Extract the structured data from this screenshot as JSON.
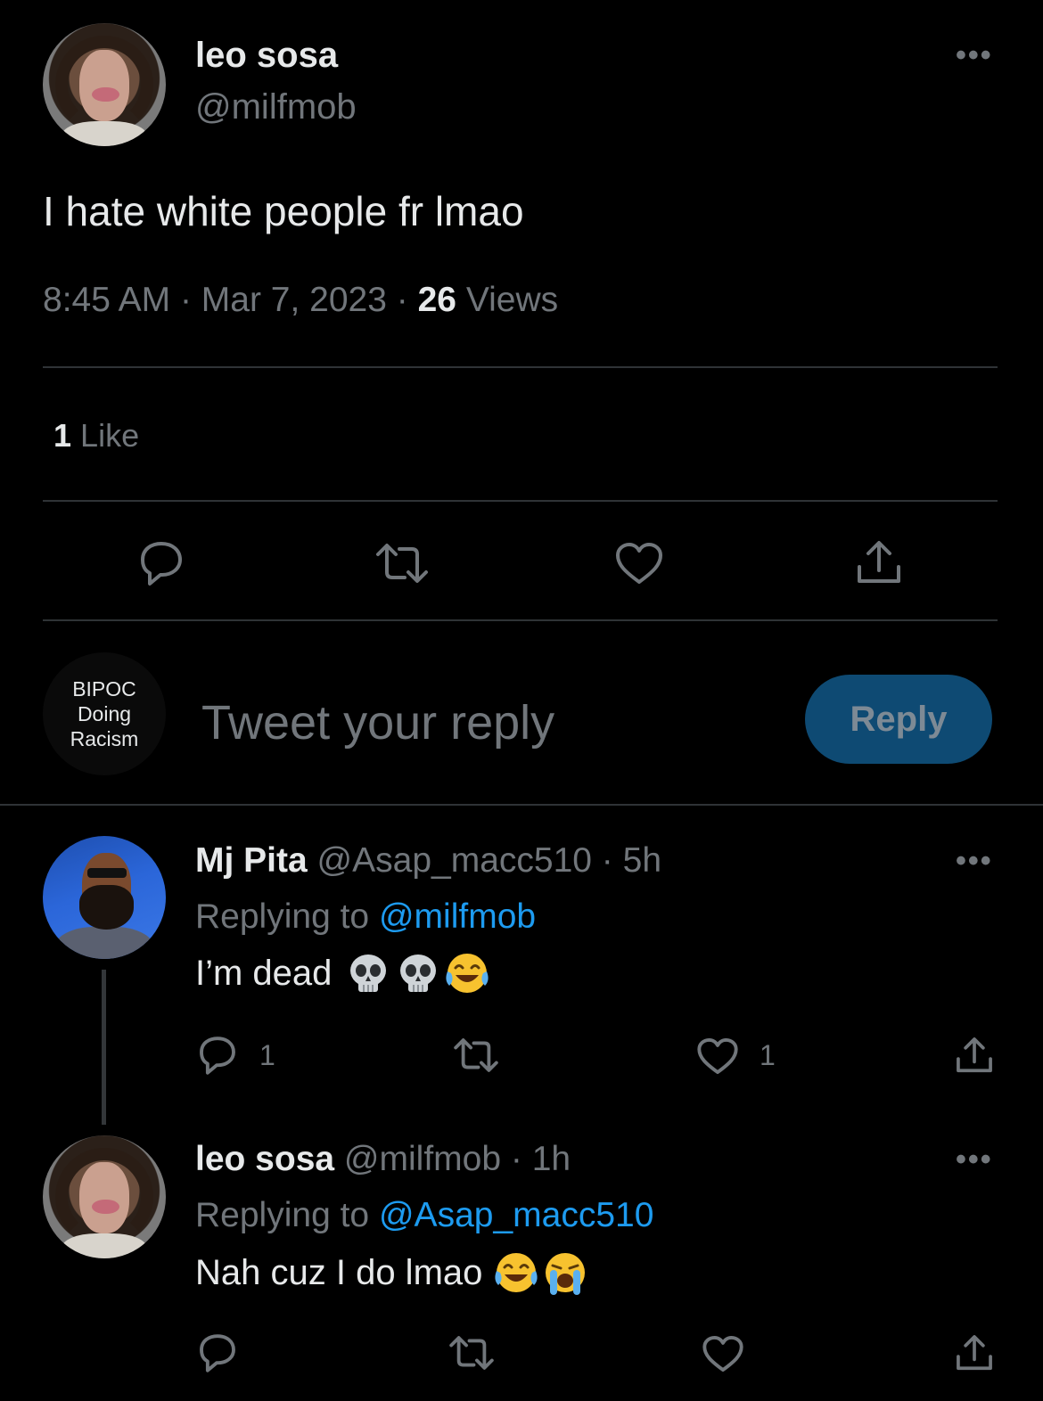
{
  "main_tweet": {
    "author_name": "leo sosa",
    "author_handle": "@milfmob",
    "text": "I hate white people fr lmao",
    "time": "8:45 AM",
    "sep1": "·",
    "date": "Mar 7, 2023",
    "sep2": "·",
    "views_count": "26",
    "views_label": "Views",
    "likes_count": "1",
    "likes_label": "Like"
  },
  "compose": {
    "avatar_text_line1": "BIPOC",
    "avatar_text_line2": "Doing",
    "avatar_text_line3": "Racism",
    "placeholder": "Tweet your reply",
    "reply_button": "Reply"
  },
  "replies": [
    {
      "author_name": "Mj Pita",
      "author_handle": "@Asap_macc510",
      "sep": "·",
      "age": "5h",
      "replying_label": "Replying to",
      "replying_to": "@milfmob",
      "text": "I’m dead",
      "emojis": [
        "skull",
        "skull",
        "tears-of-joy"
      ],
      "reply_count": "1",
      "like_count": "1"
    },
    {
      "author_name": "leo sosa",
      "author_handle": "@milfmob",
      "sep": "·",
      "age": "1h",
      "replying_label": "Replying to",
      "replying_to": "@Asap_macc510",
      "text": "Nah cuz I do lmao",
      "emojis": [
        "tears-of-joy",
        "loudly-crying"
      ]
    }
  ],
  "colors": {
    "background": "#000000",
    "text": "#e7e9ea",
    "muted": "#71767b",
    "link": "#1d9bf0",
    "reply_button_bg": "#0e4a73",
    "divider": "#2f3336"
  }
}
